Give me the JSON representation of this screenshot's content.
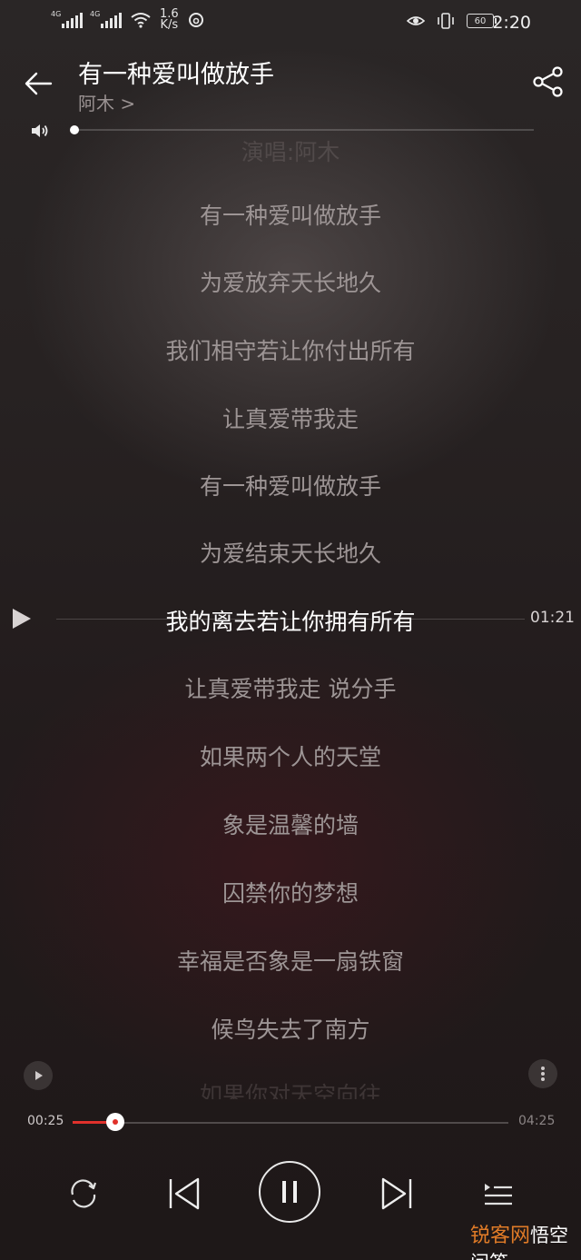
{
  "status_bar": {
    "network_1": "4G",
    "network_2": "4G",
    "speed_value": "1.6",
    "speed_unit": "K/s",
    "battery": "60",
    "time": "2:20"
  },
  "header": {
    "title": "有一种爱叫做放手",
    "artist": "阿木 >"
  },
  "volume": {
    "level": 0.0
  },
  "lyrics": [
    "演唱:阿木",
    "有一种爱叫做放手",
    "为爱放弃天长地久",
    "我们相守若让你付出所有",
    "让真爱带我走",
    "有一种爱叫做放手",
    "为爱结束天长地久",
    "我的离去若让你拥有所有",
    "让真爱带我走 说分手",
    "如果两个人的天堂",
    "象是温馨的墙",
    "囚禁你的梦想",
    "幸福是否象是一扇铁窗",
    "候鸟失去了南方",
    "如果你对天空向往"
  ],
  "active_lyric_index": 7,
  "lyric_marker_time": "01:21",
  "player": {
    "elapsed": "00:25",
    "total": "04:25",
    "progress_fraction": 0.098
  },
  "watermark": {
    "part1": "锐客网",
    "part2": "悟空问答"
  },
  "colors": {
    "accent": "#e0312b",
    "active_text": "#ffffff",
    "inactive_text": "#9d9595"
  }
}
